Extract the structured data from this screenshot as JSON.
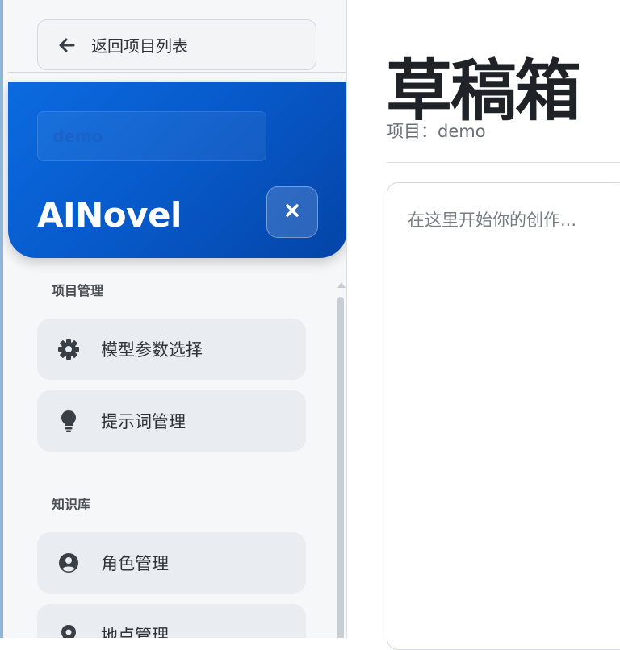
{
  "sidebar": {
    "back_label": "返回项目列表",
    "project_selector": "demo",
    "app_title": "AINovel",
    "sections": [
      {
        "title": "项目管理",
        "items": [
          {
            "label": "模型参数选择",
            "icon": "gear-icon"
          },
          {
            "label": "提示词管理",
            "icon": "lightbulb-icon"
          }
        ]
      },
      {
        "title": "知识库",
        "items": [
          {
            "label": "角色管理",
            "icon": "user-circle-icon"
          },
          {
            "label": "地点管理",
            "icon": "map-pin-icon"
          }
        ]
      }
    ]
  },
  "main": {
    "title": "草稿箱",
    "project_line": "项目：demo",
    "editor_placeholder": "在这里开始你的创作..."
  },
  "colors": {
    "brand_blue": "#0757c6",
    "sidebar_bg": "#f6f7f9",
    "nav_item_bg": "#e9ecf0"
  }
}
